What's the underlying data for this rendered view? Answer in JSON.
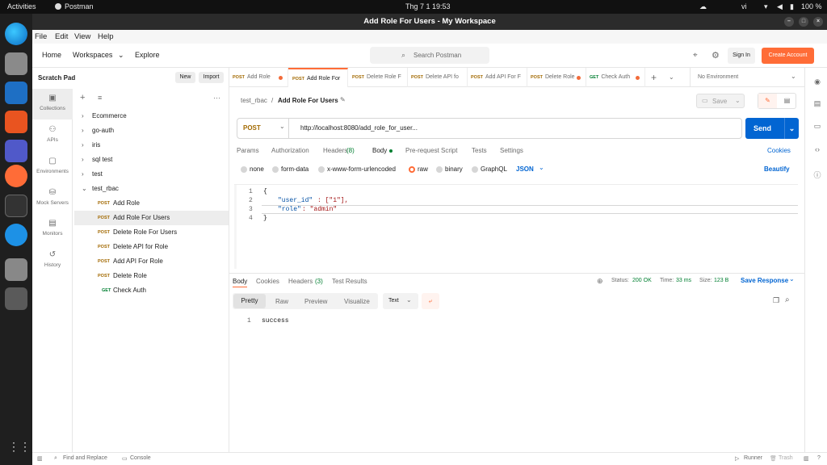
{
  "system": {
    "activities": "Activities",
    "app": "Postman",
    "clock": "Thg 7 1  19:53",
    "lang": "vi",
    "battery": "100 %"
  },
  "window": {
    "title": "Add Role For Users - My Workspace"
  },
  "menu": [
    "File",
    "Edit",
    "View",
    "Help"
  ],
  "header": {
    "home": "Home",
    "workspaces": "Workspaces",
    "explore": "Explore",
    "search_placeholder": "Search Postman",
    "sign_in": "Sign In",
    "create_account": "Create Account"
  },
  "left": {
    "title": "Scratch Pad",
    "new": "New",
    "import": "Import",
    "rail": [
      "Collections",
      "APIs",
      "Environments",
      "Mock Servers",
      "Monitors",
      "History"
    ],
    "folders": [
      "Ecommerce",
      "go-auth",
      "iris",
      "sql test",
      "test",
      "test_rbac"
    ],
    "requests": [
      {
        "method": "POST",
        "name": "Add Role"
      },
      {
        "method": "POST",
        "name": "Add Role For Users"
      },
      {
        "method": "POST",
        "name": "Delete Role For Users"
      },
      {
        "method": "POST",
        "name": "Delete API for Role"
      },
      {
        "method": "POST",
        "name": "Add API For Role"
      },
      {
        "method": "POST",
        "name": "Delete Role"
      },
      {
        "method": "GET",
        "name": "Check Auth"
      }
    ]
  },
  "tabs": [
    {
      "method": "POST",
      "name": "Add Role"
    },
    {
      "method": "POST",
      "name": "Add Role For"
    },
    {
      "method": "POST",
      "name": "Delete Role F"
    },
    {
      "method": "POST",
      "name": "Delete API fo"
    },
    {
      "method": "POST",
      "name": "Add API For F"
    },
    {
      "method": "POST",
      "name": "Delete Role"
    },
    {
      "method": "GET",
      "name": "Check Auth"
    }
  ],
  "environment": "No Environment",
  "request": {
    "breadcrumb_parent": "test_rbac",
    "breadcrumb_sep": "/",
    "breadcrumb_current": "Add Role For Users",
    "save": "Save",
    "method": "POST",
    "url": "http://localhost:8080/add_role_for_user...",
    "send": "Send",
    "tabs": [
      "Params",
      "Authorization",
      "Headers",
      "Body",
      "Pre-request Script",
      "Tests",
      "Settings"
    ],
    "headers_count": "(8)",
    "cookies": "Cookies",
    "body_types": [
      "none",
      "form-data",
      "x-www-form-urlencoded",
      "raw",
      "binary",
      "GraphQL"
    ],
    "format": "JSON",
    "beautify": "Beautify",
    "lines": [
      "1",
      "2",
      "3",
      "4"
    ],
    "code": {
      "open": "{",
      "key1": "\"user_id\"",
      "val1": ": [\"1\"],",
      "key2": "\"role\"",
      "val2": ": \"admin\"",
      "close": "}"
    }
  },
  "response": {
    "tabs": [
      "Body",
      "Cookies",
      "Headers",
      "Test Results"
    ],
    "headers_count": "(3)",
    "status_label": "Status:",
    "status": "200 OK",
    "time_label": "Time:",
    "time": "33 ms",
    "size_label": "Size:",
    "size": "123 B",
    "save_response": "Save Response",
    "views": [
      "Pretty",
      "Raw",
      "Preview",
      "Visualize"
    ],
    "type": "Text",
    "line": "1",
    "body": "success"
  },
  "statusbar": {
    "find": "Find and Replace",
    "console": "Console",
    "runner": "Runner",
    "trash": "Trash"
  },
  "colors": {
    "accent": "#ff6c37",
    "send": "#0265d2",
    "ok": "#007f31",
    "active_bg": "#ededed"
  }
}
